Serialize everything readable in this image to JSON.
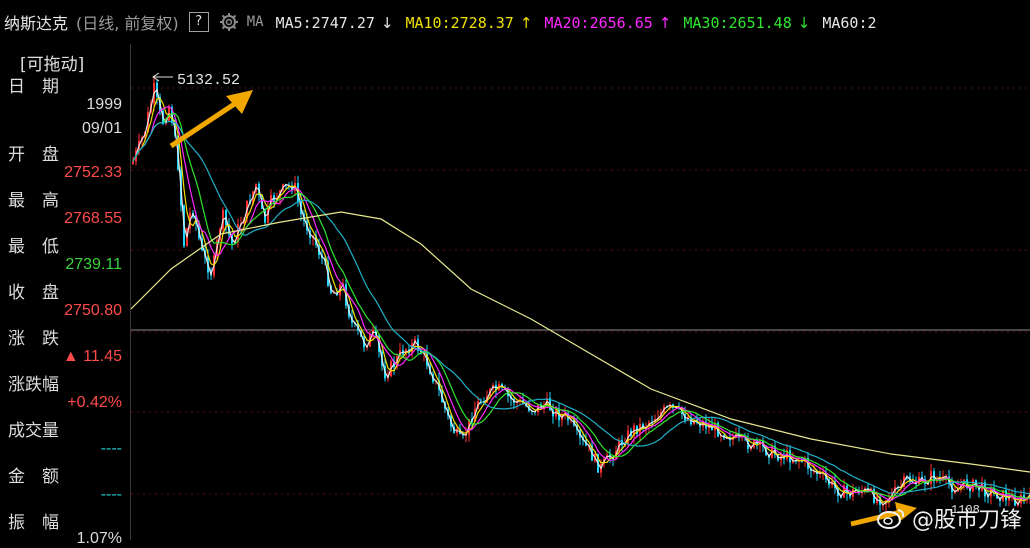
{
  "header": {
    "title": "纳斯达克",
    "subtitle": "(日线, 前复权)",
    "help_label": "?",
    "ma_label": "MA",
    "ma_items": [
      {
        "text": "MA5:2747.27",
        "arrow": "↓",
        "color": "#e6e6e6"
      },
      {
        "text": "MA10:2728.37",
        "arrow": "↑",
        "color": "#f0e000"
      },
      {
        "text": "MA20:2656.65",
        "arrow": "↑",
        "color": "#ff28ff"
      },
      {
        "text": "MA30:2651.48",
        "arrow": "↓",
        "color": "#2ee62e"
      },
      {
        "text": "MA60:2",
        "arrow": "",
        "color": "#e6e6e6"
      }
    ]
  },
  "panel": {
    "drag_label": "[可拖动]",
    "date_label": "日　期",
    "date_year": "1999",
    "date_md": "09/01",
    "open_label": "开　盘",
    "open_value": "2752.33",
    "high_label": "最　高",
    "high_value": "2768.55",
    "low_label": "最　低",
    "low_value": "2739.11",
    "close_label": "收　盘",
    "close_value": "2750.80",
    "change_label": "涨　跌",
    "change_value": "▲ 11.45",
    "change_pct_label": "涨跌幅",
    "change_pct_value": "+0.42%",
    "volume_label": "成交量",
    "volume_value": "----",
    "amount_label": "金　额",
    "amount_value": "----",
    "amplitude_label": "振　幅",
    "amplitude_value": "1.07%"
  },
  "chart": {
    "peak_label": "5132.52",
    "low_label": "1108",
    "watermark": "@股市刀锋",
    "colors": {
      "up": "#ff3030",
      "down": "#20d8ff",
      "ma5": "#e6e6e6",
      "ma10": "#f0e000",
      "ma20": "#ff28ff",
      "ma30": "#2ee62e",
      "ma60": "#20b0c8",
      "ma250": "#e8e890",
      "arrow": "#f0a800"
    }
  }
}
